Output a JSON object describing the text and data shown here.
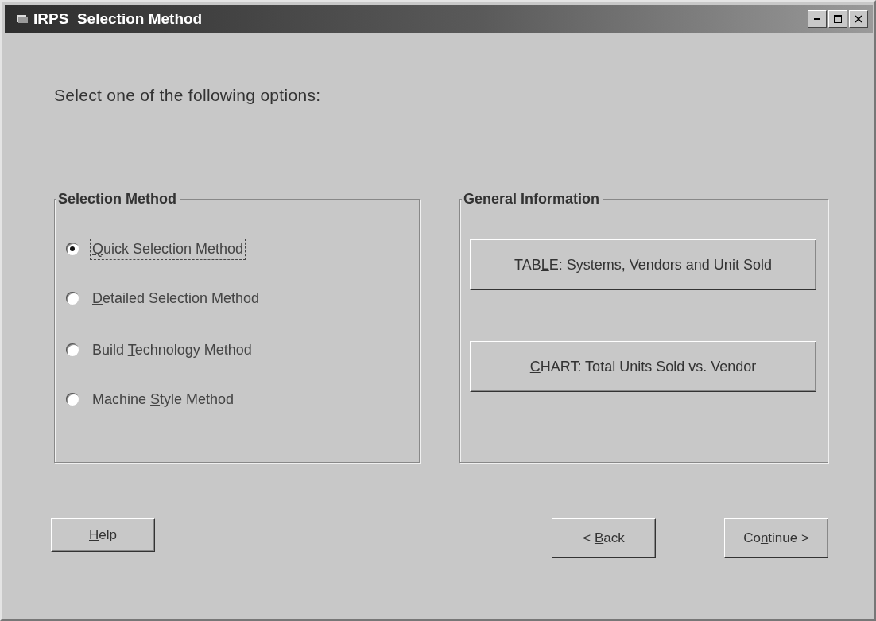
{
  "window": {
    "title": "IRPS_Selection Method"
  },
  "prompt": "Select one of the following options:",
  "selection_group": {
    "title": "Selection Method",
    "options": [
      {
        "label": {
          "key": "Q",
          "after": "uick Selection Method"
        },
        "selected": true,
        "focused": true
      },
      {
        "label": {
          "key": "D",
          "after": "etailed Selection Method"
        },
        "selected": false,
        "focused": false
      },
      {
        "label": {
          "before": "Build ",
          "key": "T",
          "after": "echnology Method"
        },
        "selected": false,
        "focused": false
      },
      {
        "label": {
          "before": "Machine ",
          "key": "S",
          "after": "tyle Method"
        },
        "selected": false,
        "focused": false
      }
    ]
  },
  "info_group": {
    "title": "General Information",
    "buttons": [
      {
        "label": {
          "before": "TAB",
          "key": "L",
          "after": "E: Systems, Vendors and Unit Sold"
        }
      },
      {
        "label": {
          "key": "C",
          "after": "HART: Total Units Sold vs. Vendor"
        }
      }
    ]
  },
  "buttons": [
    {
      "kind": "help",
      "label": {
        "key": "H",
        "after": "elp"
      }
    },
    {
      "kind": "back",
      "label": {
        "before": "< ",
        "key": "B",
        "after": "ack"
      }
    },
    {
      "kind": "continue",
      "label": {
        "before": "Co",
        "key": "n",
        "after": "tinue >"
      }
    }
  ]
}
